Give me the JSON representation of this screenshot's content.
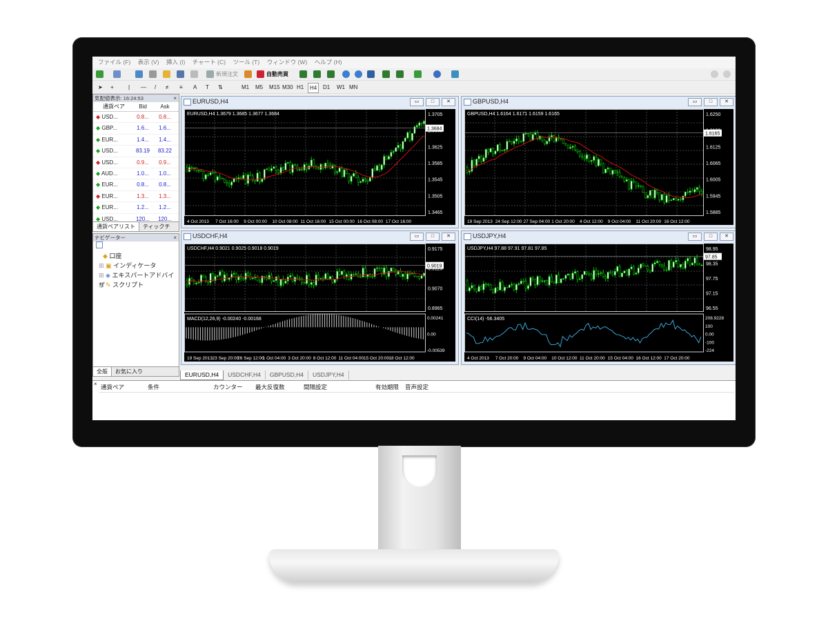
{
  "menu": [
    "ファイル (F)",
    "表示 (V)",
    "挿入 (I)",
    "チャート (C)",
    "ツール (T)",
    "ウィンドウ (W)",
    "ヘルプ (H)"
  ],
  "toolbar": {
    "new_order": "新規注文",
    "auto_trade": "自動売買",
    "timeframes": [
      "M1",
      "M5",
      "M15",
      "M30",
      "H1",
      "H4",
      "D1",
      "W1",
      "MN"
    ]
  },
  "market_watch": {
    "title": "気配値表示: 16:24:53",
    "headers": {
      "symbol": "通貨ペア",
      "bid": "Bid",
      "ask": "Ask"
    },
    "rows": [
      {
        "symbol": "USD...",
        "bid": "0.8...",
        "ask": "0.8...",
        "dir": "down"
      },
      {
        "symbol": "GBP...",
        "bid": "1.6...",
        "ask": "1.6...",
        "dir": "up"
      },
      {
        "symbol": "EUR...",
        "bid": "1.4...",
        "ask": "1.4...",
        "dir": "up"
      },
      {
        "symbol": "USD...",
        "bid": "83.19",
        "ask": "83.22",
        "dir": "up"
      },
      {
        "symbol": "USD...",
        "bid": "0.9...",
        "ask": "0.9...",
        "dir": "down"
      },
      {
        "symbol": "AUD...",
        "bid": "1.0...",
        "ask": "1.0...",
        "dir": "up"
      },
      {
        "symbol": "EUR...",
        "bid": "0.8...",
        "ask": "0.8...",
        "dir": "up"
      },
      {
        "symbol": "EUR...",
        "bid": "1.3...",
        "ask": "1.3...",
        "dir": "down"
      },
      {
        "symbol": "EUR...",
        "bid": "1.2...",
        "ask": "1.2...",
        "dir": "up"
      },
      {
        "symbol": "USD...",
        "bid": "120...",
        "ask": "120...",
        "dir": "up"
      }
    ],
    "tabs": [
      "通貨ペアリスト",
      "ティックチ"
    ]
  },
  "navigator": {
    "title": "ナビゲーター",
    "items": [
      "口座",
      "インディケータ",
      "エキスパートアドバイザ",
      "スクリプト"
    ],
    "tabs": [
      "全般",
      "お気に入り"
    ]
  },
  "charts": [
    {
      "title": "EURUSD,H4",
      "header": "EURUSD,H4  1.3679 1.3685 1.3677 1.3684",
      "prices": [
        "1.3705",
        "1.3665",
        "1.3625",
        "1.3585",
        "1.3545",
        "1.3505",
        "1.3465"
      ],
      "current": "1.3684",
      "dates": [
        "4 Oct 2013",
        "7 Oct 16:00",
        "9 Oct 00:00",
        "10 Oct 08:00",
        "11 Oct 16:00",
        "15 Oct 00:00",
        "16 Oct 08:00",
        "17 Oct 16:00"
      ]
    },
    {
      "title": "GBPUSD,H4",
      "header": "GBPUSD,H4  1.6164 1.6171 1.6159 1.6165",
      "prices": [
        "1.6250",
        "1.6190",
        "1.6125",
        "1.6065",
        "1.6005",
        "1.5945",
        "1.5885"
      ],
      "current": "1.6165",
      "dates": [
        "19 Sep 2013",
        "24 Sep 12:00",
        "27 Sep 04:00",
        "1 Oct 20:00",
        "4 Oct 12:00",
        "9 Oct 04:00",
        "11 Oct 20:00",
        "16 Oct 12:00"
      ]
    },
    {
      "title": "USDCHF,H4",
      "header": "USDCHF,H4  0.9021 0.9025 0.9018 0.9019",
      "prices": [
        "0.9175",
        "0.9125",
        "0.9070",
        "0.8965"
      ],
      "current": "0.9019",
      "indicator": "MACD(12,26,9) -0.00240 -0.00168",
      "ind_levels": [
        "0.00241",
        "0.00",
        "-0.00539"
      ],
      "dates": [
        "19 Sep 2013",
        "23 Sep 20:00",
        "26 Sep 12:00",
        "1 Oct 04:00",
        "3 Oct 20:00",
        "8 Oct 12:00",
        "11 Oct 04:00",
        "15 Oct 20:00",
        "18 Oct 12:00"
      ]
    },
    {
      "title": "USDJPY,H4",
      "header": "USDJPY,H4  97.88 97.91 97.81 97.85",
      "prices": [
        "98.95",
        "98.35",
        "97.75",
        "97.15",
        "96.55"
      ],
      "current": "97.85",
      "indicator": "CCI(14) -56.3405",
      "ind_levels": [
        "208.9228",
        "100",
        "0.00",
        "-100",
        "-224"
      ],
      "dates": [
        "4 Oct 2013",
        "7 Oct 20:00",
        "9 Oct 04:00",
        "10 Oct 12:00",
        "11 Oct 20:00",
        "15 Oct 04:00",
        "16 Oct 12:00",
        "17 Oct 20:00"
      ]
    }
  ],
  "chart_tabs": [
    "EURUSD,H4",
    "USDCHF,H4",
    "GBPUSD,H4",
    "USDJPY,H4"
  ],
  "terminal_headers": [
    "通貨ペア",
    "条件",
    "カウンター",
    "最大反復数",
    "間隔設定",
    "有効期限",
    "音声設定"
  ],
  "colors": {
    "up": "#19a319",
    "down": "#d22020",
    "bull_candle": "#00d000",
    "ma_line": "#cc1010"
  }
}
